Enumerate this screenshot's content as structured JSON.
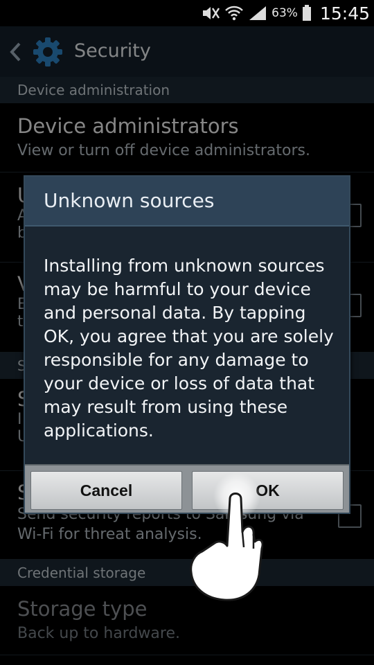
{
  "status_bar": {
    "battery_pct": "63%",
    "time": "15:45",
    "icons": [
      "mute-icon",
      "wifi-icon",
      "signal-icon",
      "battery-icon"
    ]
  },
  "action_bar": {
    "title": "Security",
    "icons": [
      "back-chevron-icon",
      "settings-gear-icon"
    ]
  },
  "list": {
    "device_admin_header": "Device administration",
    "device_admins": {
      "title": "Device administrators",
      "summary": "View or turn off device administrators."
    },
    "unknown_sources_partial": {
      "title_char": "U",
      "summary_chars": [
        "A",
        "b"
      ]
    },
    "verify_apps_partial": {
      "title_char": "V",
      "summary_chars": [
        "E",
        "t"
      ]
    },
    "section2_partial": {
      "header_char": "S"
    },
    "item3_partial": {
      "title_char": "S",
      "summary_chars": [
        "I",
        "U"
      ]
    },
    "security_reports": {
      "title_char": "S",
      "summary": "Send security reports to Samsung via Wi-Fi for threat analysis."
    },
    "credential_header": "Credential storage",
    "storage_type": {
      "title": "Storage type",
      "summary": "Back up to hardware."
    }
  },
  "dialog": {
    "title": "Unknown sources",
    "message": "Installing from unknown sources may be harmful to your device and personal data. By tapping OK, you agree that you are solely responsible for any damage to your device or loss of data that may result from using these applications.",
    "cancel_label": "Cancel",
    "ok_label": "OK"
  },
  "overlay": {
    "icons": [
      "touch-hand-icon"
    ]
  },
  "colors": {
    "action_bar": "#15202b",
    "section_header": "#1c2833",
    "dialog_title_bar": "#2e4357",
    "dialog_body": "#1a2530",
    "button_face": "#d6d8da"
  }
}
